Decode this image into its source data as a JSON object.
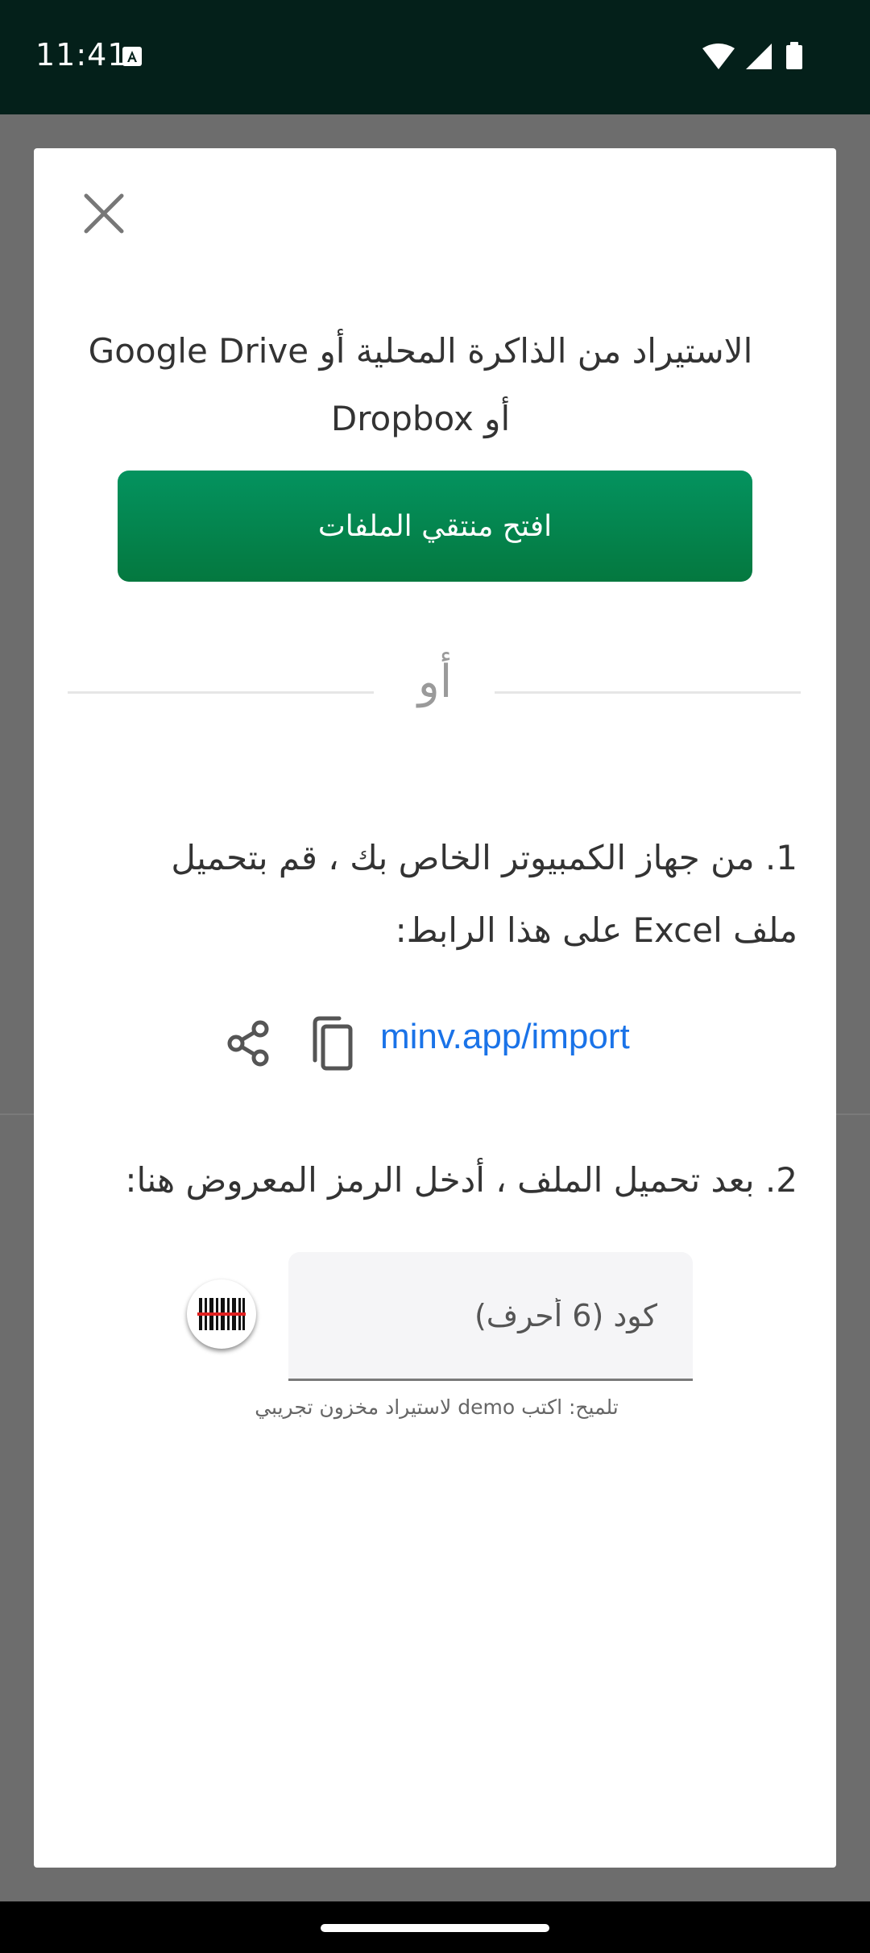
{
  "status_bar": {
    "time": "11:41",
    "icons": [
      "notification-a-icon",
      "wifi-icon",
      "signal-icon",
      "battery-icon"
    ]
  },
  "dialog": {
    "close_icon": "close-icon",
    "title": "الاستيراد من الذاكرة المحلية أو Google Drive أو Dropbox",
    "open_picker_label": "افتح منتقي الملفات",
    "divider_label": "أو",
    "step1": "1. من جهاز الكمبيوتر الخاص بك ، قم بتحميل ملف Excel على هذا الرابط:",
    "link": "minv.app/import",
    "share_icon": "share-icon",
    "copy_icon": "copy-icon",
    "step2": "2. بعد تحميل الملف ، أدخل الرمز المعروض هنا:",
    "code_placeholder": "كود (6 أحرف)",
    "code_value": "",
    "barcode_icon": "barcode-scanner-icon",
    "hint": "تلميح: اكتب demo لاستيراد مخزون تجريبي"
  },
  "colors": {
    "status_bar_bg": "#04201a",
    "primary_button": "#04853f",
    "link": "#1a73e8",
    "scrim": "#6d6d6d"
  }
}
